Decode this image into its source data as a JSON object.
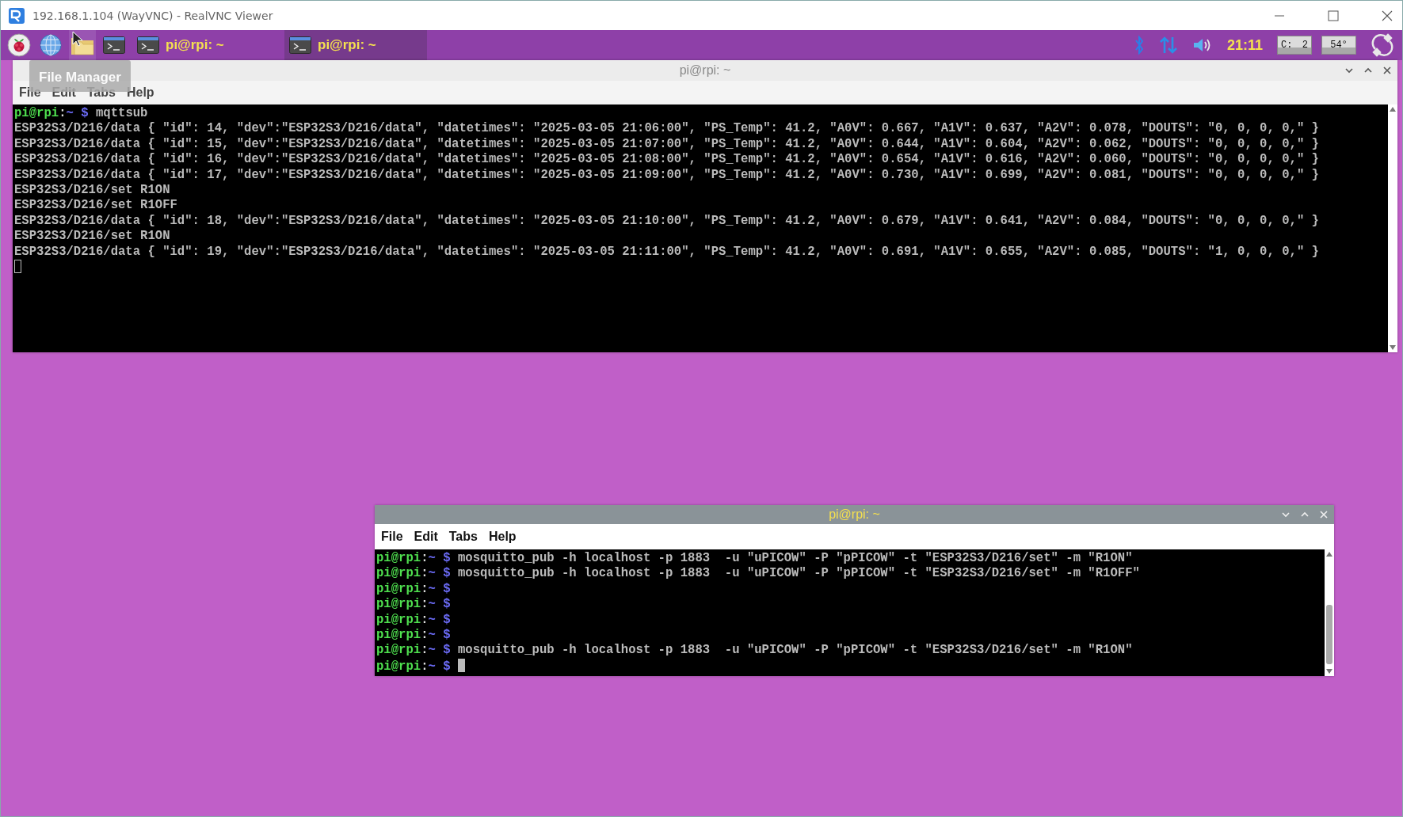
{
  "vnc_window": {
    "title": "192.168.1.104 (WayVNC) - RealVNC Viewer"
  },
  "taskbar": {
    "launchers": [
      {
        "kind": "raspberry",
        "hovered": false
      },
      {
        "kind": "globe",
        "hovered": false
      },
      {
        "kind": "folder",
        "hovered": true
      },
      {
        "kind": "terminal",
        "hovered": false
      }
    ],
    "tasks": [
      {
        "label": "pi@rpi: ~",
        "selected": false
      },
      {
        "label": "pi@rpi: ~",
        "selected": true
      }
    ],
    "tray": {
      "clock": "21:11",
      "cpu_label": "C:",
      "cpu_value": "2",
      "temperature": "54°"
    }
  },
  "tooltip": {
    "text": "File Manager"
  },
  "windows": [
    {
      "title": "pi@rpi: ~",
      "active": false,
      "menu": [
        "File",
        "Edit",
        "Tabs",
        "Help"
      ],
      "terminal": {
        "cursor_focused": false,
        "lines": [
          {
            "kind": "prompt",
            "user": "pi@rpi",
            "sep": ":",
            "path": "~",
            "symbol": "$",
            "command": "mqttsub"
          },
          {
            "kind": "output",
            "text": "ESP32S3/D216/data { \"id\": 14, \"dev\":\"ESP32S3/D216/data\", \"datetimes\": \"2025-03-05 21:06:00\", \"PS_Temp\": 41.2, \"A0V\": 0.667, \"A1V\": 0.637, \"A2V\": 0.078, \"DOUTS\": \"0, 0, 0, 0,\" }"
          },
          {
            "kind": "output",
            "text": "ESP32S3/D216/data { \"id\": 15, \"dev\":\"ESP32S3/D216/data\", \"datetimes\": \"2025-03-05 21:07:00\", \"PS_Temp\": 41.2, \"A0V\": 0.644, \"A1V\": 0.604, \"A2V\": 0.062, \"DOUTS\": \"0, 0, 0, 0,\" }"
          },
          {
            "kind": "output",
            "text": "ESP32S3/D216/data { \"id\": 16, \"dev\":\"ESP32S3/D216/data\", \"datetimes\": \"2025-03-05 21:08:00\", \"PS_Temp\": 41.2, \"A0V\": 0.654, \"A1V\": 0.616, \"A2V\": 0.060, \"DOUTS\": \"0, 0, 0, 0,\" }"
          },
          {
            "kind": "output",
            "text": "ESP32S3/D216/data { \"id\": 17, \"dev\":\"ESP32S3/D216/data\", \"datetimes\": \"2025-03-05 21:09:00\", \"PS_Temp\": 41.2, \"A0V\": 0.730, \"A1V\": 0.699, \"A2V\": 0.081, \"DOUTS\": \"0, 0, 0, 0,\" }"
          },
          {
            "kind": "output",
            "text": "ESP32S3/D216/set R1ON"
          },
          {
            "kind": "output",
            "text": "ESP32S3/D216/set R1OFF"
          },
          {
            "kind": "output",
            "text": "ESP32S3/D216/data { \"id\": 18, \"dev\":\"ESP32S3/D216/data\", \"datetimes\": \"2025-03-05 21:10:00\", \"PS_Temp\": 41.2, \"A0V\": 0.679, \"A1V\": 0.641, \"A2V\": 0.084, \"DOUTS\": \"0, 0, 0, 0,\" }"
          },
          {
            "kind": "output",
            "text": "ESP32S3/D216/set R1ON"
          },
          {
            "kind": "output",
            "text": "ESP32S3/D216/data { \"id\": 19, \"dev\":\"ESP32S3/D216/data\", \"datetimes\": \"2025-03-05 21:11:00\", \"PS_Temp\": 41.2, \"A0V\": 0.691, \"A1V\": 0.655, \"A2V\": 0.085, \"DOUTS\": \"1, 0, 0, 0,\" }"
          }
        ]
      }
    },
    {
      "title": "pi@rpi: ~",
      "active": true,
      "menu": [
        "File",
        "Edit",
        "Tabs",
        "Help"
      ],
      "terminal": {
        "cursor_focused": true,
        "lines": [
          {
            "kind": "prompt",
            "user": "pi@rpi",
            "sep": ":",
            "path": "~",
            "symbol": "$",
            "command": "mosquitto_pub -h localhost -p 1883  -u \"uPICOW\" -P \"pPICOW\" -t \"ESP32S3/D216/set\" -m \"R1ON\""
          },
          {
            "kind": "prompt",
            "user": "pi@rpi",
            "sep": ":",
            "path": "~",
            "symbol": "$",
            "command": "mosquitto_pub -h localhost -p 1883  -u \"uPICOW\" -P \"pPICOW\" -t \"ESP32S3/D216/set\" -m \"R1OFF\""
          },
          {
            "kind": "prompt",
            "user": "pi@rpi",
            "sep": ":",
            "path": "~",
            "symbol": "$"
          },
          {
            "kind": "prompt",
            "user": "pi@rpi",
            "sep": ":",
            "path": "~",
            "symbol": "$"
          },
          {
            "kind": "prompt",
            "user": "pi@rpi",
            "sep": ":",
            "path": "~",
            "symbol": "$"
          },
          {
            "kind": "prompt",
            "user": "pi@rpi",
            "sep": ":",
            "path": "~",
            "symbol": "$"
          },
          {
            "kind": "prompt",
            "user": "pi@rpi",
            "sep": ":",
            "path": "~",
            "symbol": "$",
            "command": "mosquitto_pub -h localhost -p 1883  -u \"uPICOW\" -P \"pPICOW\" -t \"ESP32S3/D216/set\" -m \"R1ON\""
          },
          {
            "kind": "prompt",
            "user": "pi@rpi",
            "sep": ":",
            "path": "~",
            "symbol": "$"
          }
        ]
      }
    }
  ]
}
